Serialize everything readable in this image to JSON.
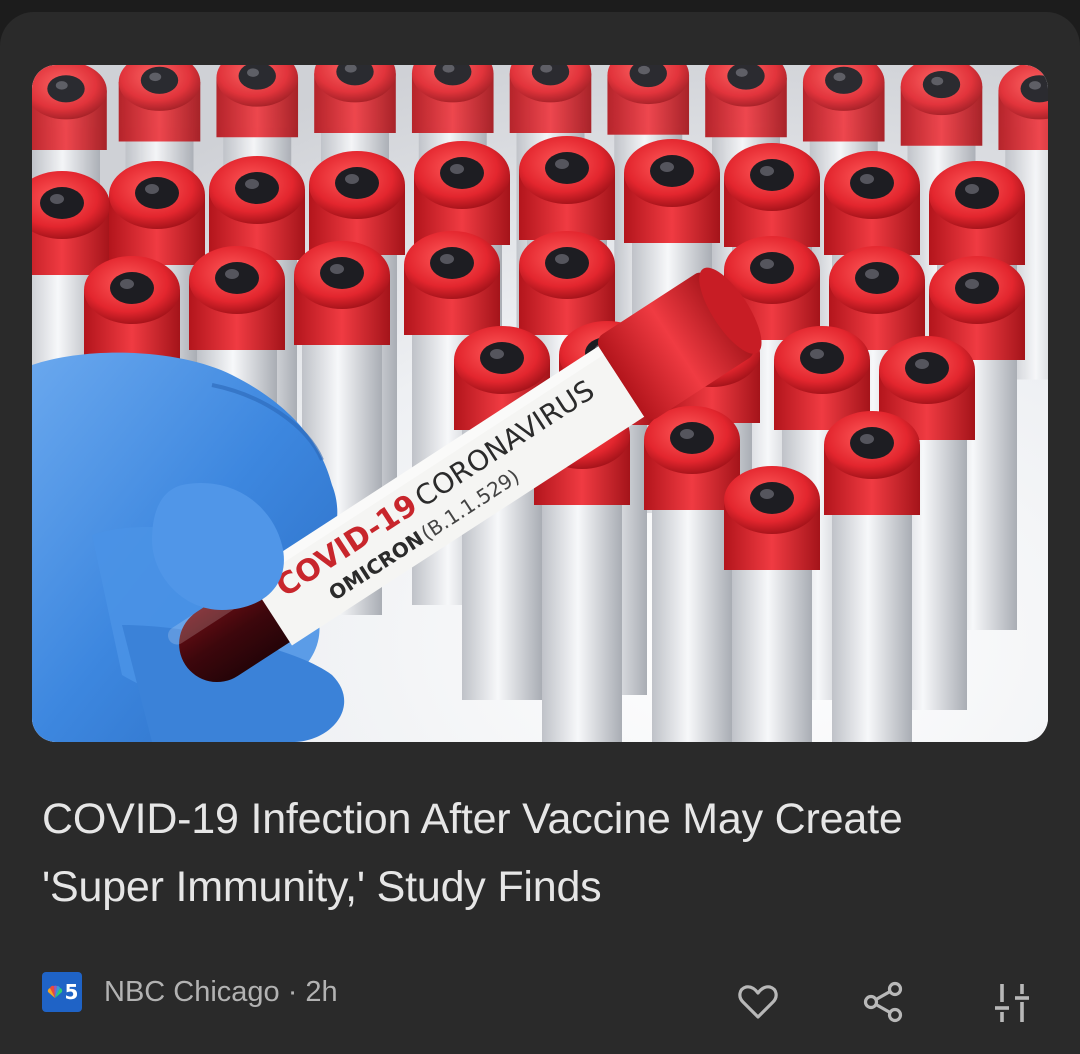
{
  "article": {
    "headline": "COVID-19 Infection After Vaccine May Create 'Super Immunity,' Study Finds",
    "source": "NBC Chicago",
    "separator": "·",
    "age": "2h",
    "source_logo_number": "5"
  },
  "image": {
    "label_line1_red": "COVID-19",
    "label_line1_dark": "CORONAVIRUS",
    "label_line2_dark": "OMICRON",
    "label_line2_light": "(B.1.1.529)"
  },
  "actions": {
    "like_icon": "heart-icon",
    "share_icon": "share-icon",
    "more_icon": "tune-icon"
  },
  "colors": {
    "background": "#1c1c1c",
    "card": "#2a2a2a",
    "headline_text": "#e6e6e6",
    "meta_text": "#b2b2b2",
    "icon": "#b8b8b8",
    "logo_blue": "#1f63c6",
    "cap_red": "#d8222b"
  }
}
